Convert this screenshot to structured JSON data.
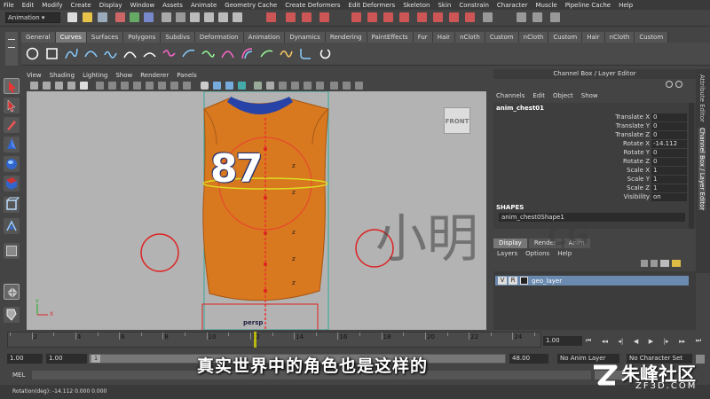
{
  "menu": [
    "File",
    "Edit",
    "Modify",
    "Create",
    "Display",
    "Window",
    "Assets",
    "Animate",
    "Geometry Cache",
    "Create Deformers",
    "Edit Deformers",
    "Skeleton",
    "Skin",
    "Constrain",
    "Character",
    "Muscle",
    "Pipeline Cache",
    "Help"
  ],
  "status": {
    "mode": "Animation"
  },
  "shelf_tabs": [
    "General",
    "Curves",
    "Surfaces",
    "Polygons",
    "Subdivs",
    "Deformation",
    "Animation",
    "Dynamics",
    "Rendering",
    "PaintEffects",
    "Fur",
    "Hair",
    "nCloth",
    "Custom",
    "nCloth",
    "Custom",
    "Hair",
    "nCloth",
    "Custom"
  ],
  "active_shelf_tab": "Curves",
  "viewport": {
    "menu": [
      "View",
      "Shading",
      "Lighting",
      "Show",
      "Renderer",
      "Panels"
    ],
    "jersey_number": "87",
    "camera_label": "persp",
    "cube_label": "FRONT",
    "axis_y": "Y",
    "axis_x": "X",
    "z_marker": "z"
  },
  "channel_box": {
    "header": "Channel Box / Layer Editor",
    "menu": [
      "Channels",
      "Edit",
      "Object",
      "Show"
    ],
    "object_name": "anim_chest01",
    "attributes": [
      {
        "label": "Translate X",
        "value": "0"
      },
      {
        "label": "Translate Y",
        "value": "0"
      },
      {
        "label": "Translate Z",
        "value": "0"
      },
      {
        "label": "Rotate X",
        "value": "-14.112"
      },
      {
        "label": "Rotate Y",
        "value": "0"
      },
      {
        "label": "Rotate Z",
        "value": "0"
      },
      {
        "label": "Scale X",
        "value": "1"
      },
      {
        "label": "Scale Y",
        "value": "1"
      },
      {
        "label": "Scale Z",
        "value": "1"
      },
      {
        "label": "Visibility",
        "value": "on"
      }
    ],
    "shapes_label": "SHAPES",
    "shape_name": "anim_chest0Shape1"
  },
  "layer_editor": {
    "tabs": [
      "Display",
      "Render",
      "Anim"
    ],
    "menu": [
      "Layers",
      "Options",
      "Help"
    ],
    "layer": {
      "v": "V",
      "r": "R",
      "name": "geo_layer"
    }
  },
  "side_tabs": [
    "Attribute Editor",
    "Channel Box / Layer Editor"
  ],
  "timeline": {
    "ticks": [
      "2",
      "4",
      "6",
      "8",
      "10",
      "12",
      "14",
      "16",
      "18",
      "20",
      "22",
      "24"
    ],
    "current_frame": "1.00"
  },
  "range": {
    "start": "1.00",
    "playback_start": "1.00",
    "range_start_marker": "1",
    "end_value": "48.00",
    "anim_layer": "No Anim Layer",
    "character_set": "No Character Set"
  },
  "command_line": {
    "label": "MEL"
  },
  "help_line": {
    "text": "Rotation(deg):  -14.112   0.000   0.000"
  },
  "subtitle": "真实世界中的角色也是这样的",
  "watermark": {
    "main": "小明",
    "sub": "CG"
  },
  "logo": {
    "main": "朱峰社区",
    "sub": "ZF3D.COM"
  }
}
